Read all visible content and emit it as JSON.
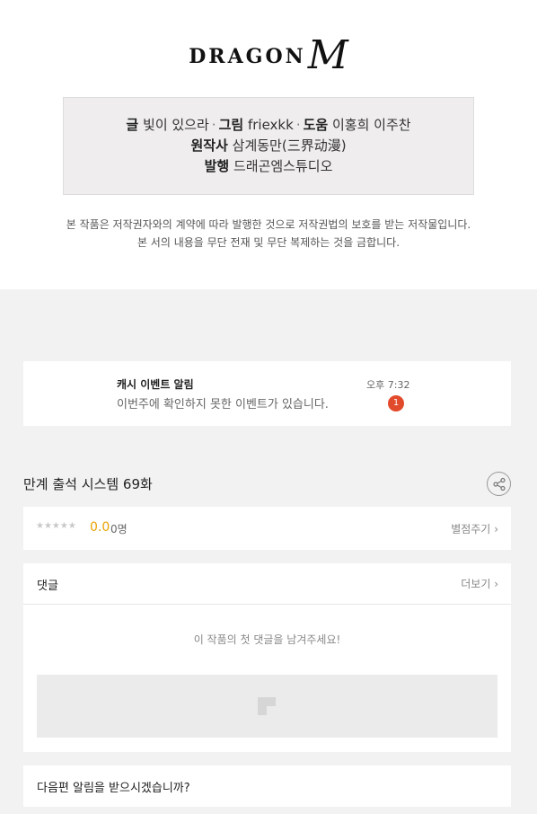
{
  "publisher": {
    "logo_word": "DRAGON",
    "logo_letter": "M"
  },
  "credits": {
    "writer_label": "글",
    "writer": "빛이 있으라",
    "artist_label": "그림",
    "artist": "friexkk",
    "assist_label": "도움",
    "assist": "이홍희 이주찬",
    "original_label": "원작사",
    "original": "삼계동만(三界动漫)",
    "publish_label": "발행",
    "publish": "드래곤엠스튜디오"
  },
  "notice": {
    "line1": "본 작품은 저작권자와의 계약에 따라 발행한 것으로 저작권법의 보호를 받는 저작물입니다.",
    "line2": "본 서의 내용을 무단 전재 및 무단 복제하는 것을 금합니다."
  },
  "alert": {
    "title": "캐시 이벤트 알림",
    "body": "이번주에 확인하지 못한 이벤트가 있습니다.",
    "time": "오후 7:32",
    "badge": "1"
  },
  "episode": {
    "title": "만계 출석 시스템 69화",
    "share_icon": "share-icon"
  },
  "rating": {
    "stars": "★★★★★",
    "score": "0.0",
    "count": "0명",
    "rate_link": "별점주기"
  },
  "comments": {
    "title": "댓글",
    "more_link": "더보기",
    "empty_message": "이 작품의 첫 댓글을 남겨주세요!"
  },
  "next_episode": {
    "prompt": "다음편 알림을 받으시겠습니까?"
  },
  "colors": {
    "accent_score": "#e8a200",
    "badge": "#e14a2a",
    "page_bg": "#f2f2f2"
  }
}
